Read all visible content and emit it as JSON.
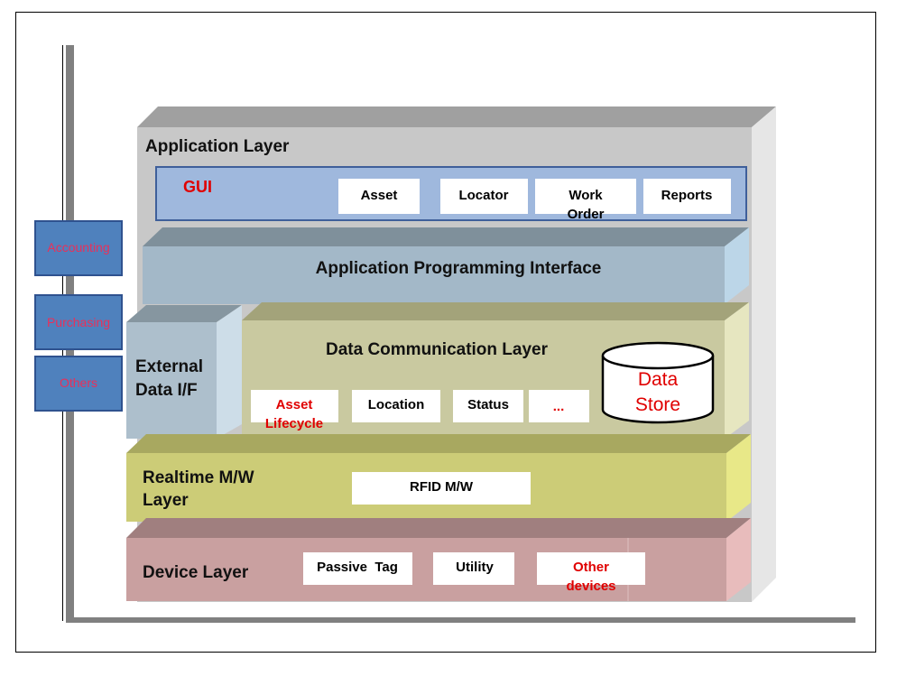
{
  "colors": {
    "application_layer": "#c8c8c8",
    "gui": "#9fb8dd",
    "api": "#a3b8c8",
    "external": "#adbfcc",
    "data_comm": "#c9c9a0",
    "realtime": "#cccc77",
    "device": "#c9a0a0",
    "side_boxes": "#4f81bd",
    "highlight_text": "#e00000"
  },
  "application_layer": {
    "title": "Application Layer",
    "gui": {
      "label": "GUI",
      "modules": [
        {
          "lines": [
            "Asset"
          ]
        },
        {
          "lines": [
            "Locator"
          ]
        },
        {
          "lines": [
            "Work",
            "Order"
          ]
        },
        {
          "lines": [
            "Reports"
          ]
        }
      ]
    }
  },
  "api_layer": {
    "title": "Application Programming Interface"
  },
  "external_data": {
    "lines": [
      "External",
      "Data I/F"
    ]
  },
  "data_comm_layer": {
    "title": "Data Communication Layer",
    "modules": [
      {
        "lines": [
          "Asset",
          "Lifecycle"
        ],
        "highlight": true
      },
      {
        "lines": [
          "Location"
        ]
      },
      {
        "lines": [
          "Status"
        ]
      },
      {
        "lines": [
          "..."
        ],
        "highlight": true
      }
    ],
    "data_store": {
      "lines": [
        "Data",
        "Store"
      ]
    }
  },
  "realtime_layer": {
    "lines": [
      "Realtime M/W",
      "Layer"
    ],
    "module": "RFID M/W"
  },
  "device_layer": {
    "title": "Device Layer",
    "modules": [
      {
        "lines": [
          "Passive  Tag"
        ]
      },
      {
        "lines": [
          "Utility"
        ]
      },
      {
        "lines": [
          "Other",
          "devices"
        ],
        "highlight": true
      }
    ]
  },
  "side_systems": [
    "Accounting",
    "Purchasing",
    "Others"
  ]
}
